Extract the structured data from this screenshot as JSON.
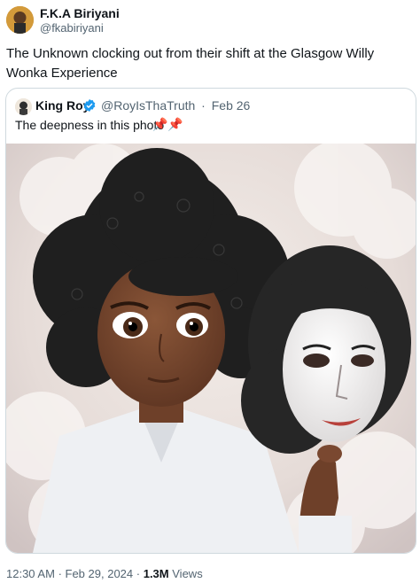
{
  "tweet": {
    "author_name": "F.K.A Biriyani",
    "author_handle": "@fkabiriyani",
    "text": "The Unknown clocking out from their shift at the Glasgow Willy Wonka Experience",
    "time": "12:30 AM",
    "date": "Feb 29, 2024",
    "views_count": "1.3M",
    "views_label": "Views"
  },
  "quote": {
    "author_name": "King Roy",
    "author_handle": "@RoyIsThaTruth",
    "date": "Feb 26",
    "text": "The deepness in this photo",
    "emoji": "📌📌",
    "verified_color": "#1d9bf0"
  },
  "colors": {
    "text_primary": "#0f1419",
    "text_secondary": "#536471",
    "border": "#cfd9de"
  }
}
